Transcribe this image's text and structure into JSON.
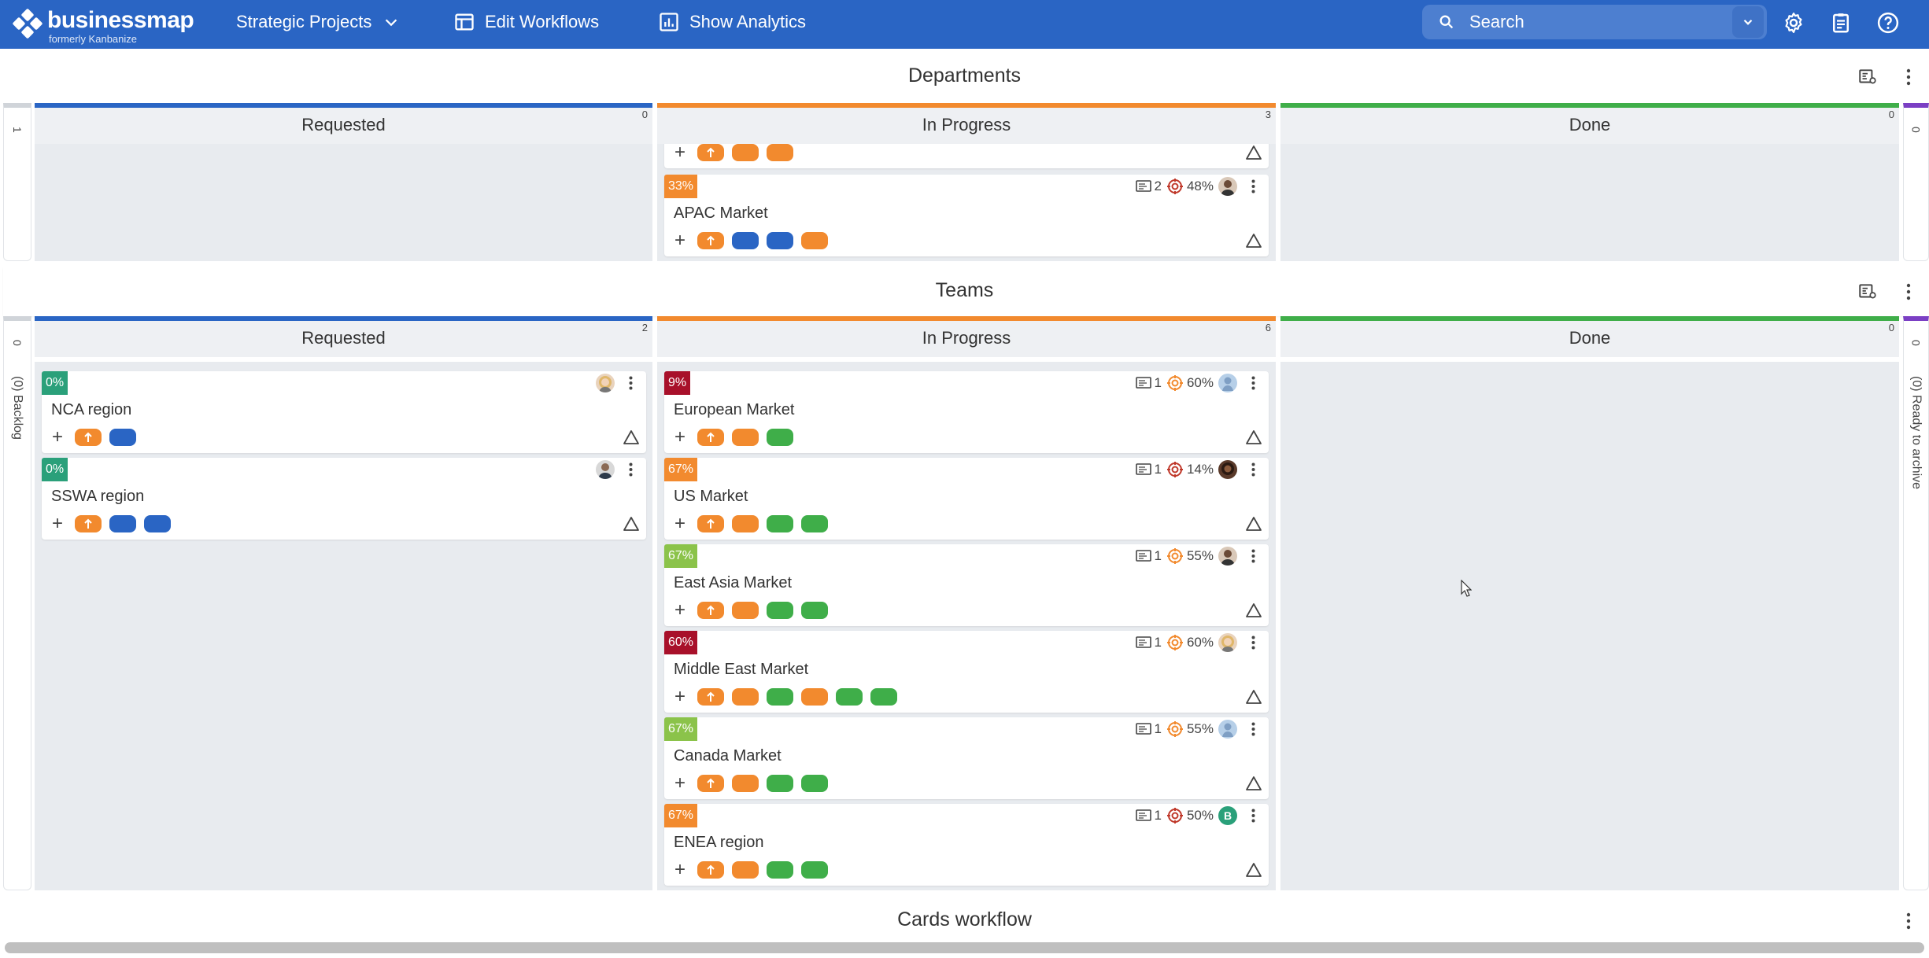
{
  "app": {
    "logo_name": "businessmap",
    "logo_sub": "formerly Kanbanize",
    "board_name": "Strategic Projects",
    "edit_workflows": "Edit Workflows",
    "show_analytics": "Show Analytics",
    "search_placeholder": "Search",
    "brand_color": "#2a65c4"
  },
  "colors": {
    "requested": "#2a65c4",
    "in_progress": "#f28a2e",
    "done": "#3fae49",
    "archive": "#7b3fc4",
    "pill_orange": "#f28a2e",
    "pill_blue": "#2a65c4",
    "pill_green": "#3fae49"
  },
  "departments": {
    "title": "Departments",
    "left_side_count": "1",
    "right_side_count": "0",
    "columns": [
      {
        "name": "Requested",
        "count": "0"
      },
      {
        "name": "In Progress",
        "count": "3"
      },
      {
        "name": "Done",
        "count": "0"
      }
    ],
    "cards": [
      {
        "title": "APAC Market",
        "pct": "33%",
        "pct_color": "#f28a2e",
        "comments": "2",
        "progress": "48%",
        "target_color": "#c0392b",
        "avatar": "man-dark"
      }
    ]
  },
  "teams": {
    "title": "Teams",
    "left_side_count": "0",
    "left_side_label": "(0) Backlog",
    "right_side_count": "0",
    "right_side_label": "(0) Ready to archive",
    "columns": [
      {
        "name": "Requested",
        "count": "2"
      },
      {
        "name": "In Progress",
        "count": "6"
      },
      {
        "name": "Done",
        "count": "0"
      }
    ],
    "requested_cards": [
      {
        "title": "NCA region",
        "pct": "0%",
        "pct_color": "#2aa07a",
        "avatar": "woman-blonde"
      },
      {
        "title": "SSWA region",
        "pct": "0%",
        "pct_color": "#2aa07a",
        "avatar": "man-suit"
      }
    ],
    "progress_cards": [
      {
        "title": "European Market",
        "pct": "9%",
        "pct_color": "#a8102a",
        "comments": "1",
        "progress": "60%",
        "target_color": "#f28a2e",
        "avatar": "placeholder-blue"
      },
      {
        "title": "US Market",
        "pct": "67%",
        "pct_color": "#f28a2e",
        "comments": "1",
        "progress": "14%",
        "target_color": "#c0392b",
        "avatar": "woman-dark"
      },
      {
        "title": "East Asia Market",
        "pct": "67%",
        "pct_color": "#8bc34a",
        "comments": "1",
        "progress": "55%",
        "target_color": "#f28a2e",
        "avatar": "man-dark"
      },
      {
        "title": "Middle East Market",
        "pct": "60%",
        "pct_color": "#a8102a",
        "comments": "1",
        "progress": "60%",
        "target_color": "#f28a2e",
        "avatar": "woman-blonde"
      },
      {
        "title": "Canada Market",
        "pct": "67%",
        "pct_color": "#8bc34a",
        "comments": "1",
        "progress": "55%",
        "target_color": "#f28a2e",
        "avatar": "placeholder-blue"
      },
      {
        "title": "ENEA region",
        "pct": "67%",
        "pct_color": "#f28a2e",
        "comments": "1",
        "progress": "50%",
        "target_color": "#c0392b",
        "avatar": "letter-b"
      }
    ],
    "avatar_letter": "B"
  },
  "cards_workflow": {
    "title": "Cards workflow"
  }
}
